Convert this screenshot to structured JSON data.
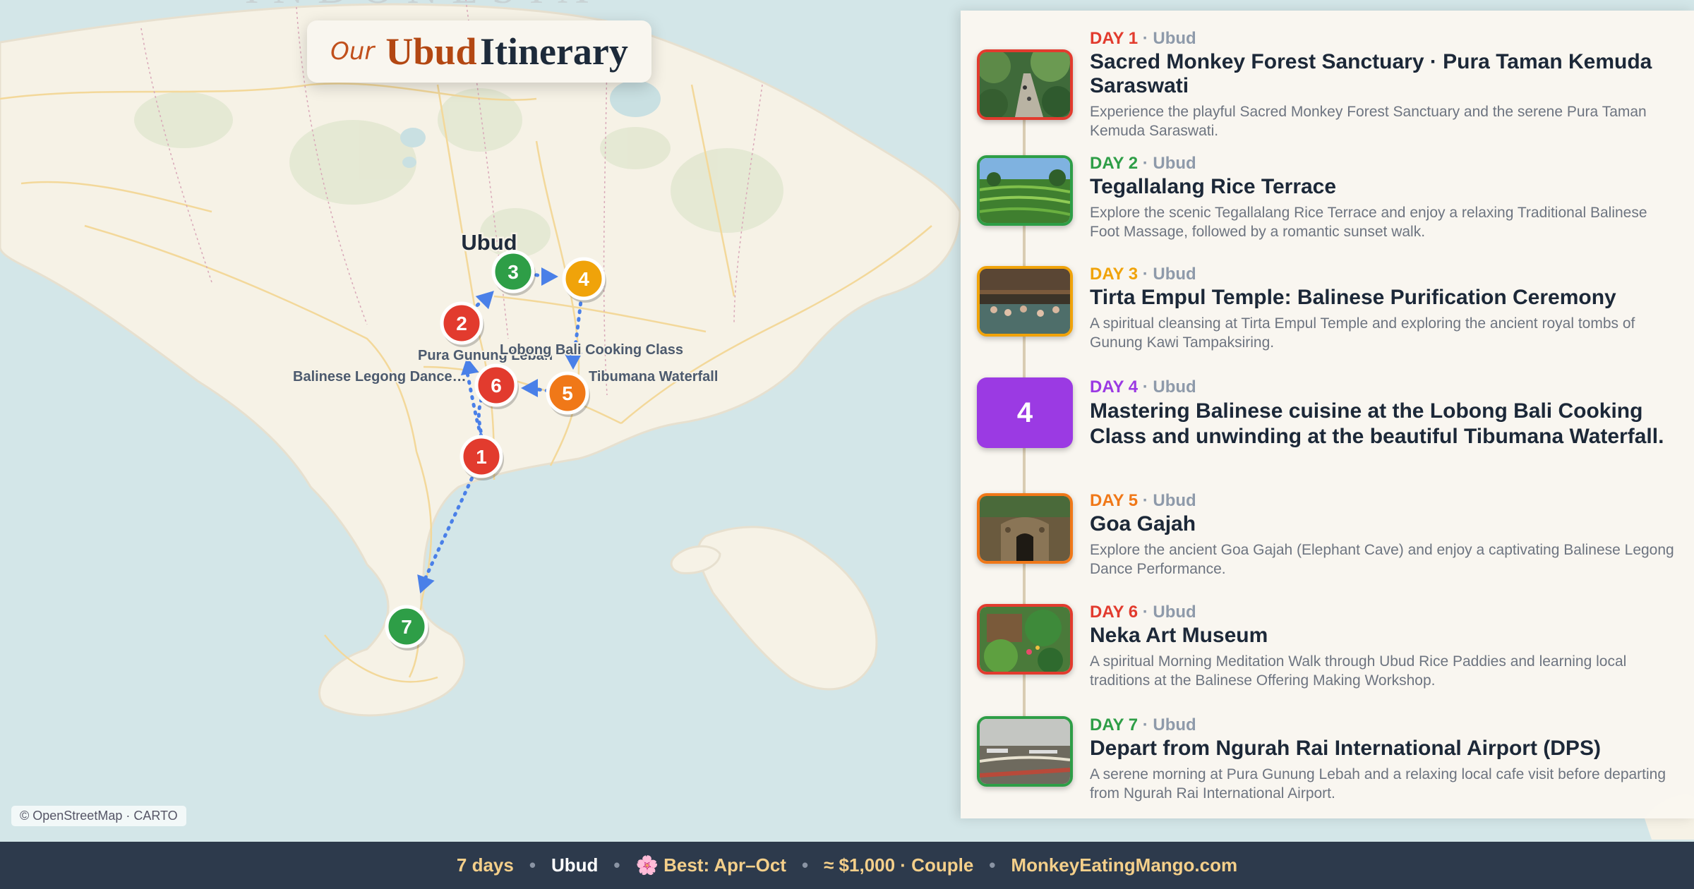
{
  "title": {
    "prefix": "Our",
    "city": "Ubud",
    "word": "Itinerary"
  },
  "map": {
    "region_label": "Ubud",
    "copyright": "© OpenStreetMap · CARTO",
    "place_labels": [
      "Pura Gunung Lebah",
      "Lobong Bali Cooking Class",
      "Balinese Legong Dance…",
      "Tibumana Waterfall"
    ],
    "markers": [
      {
        "num": "1",
        "color": "#e23b2e"
      },
      {
        "num": "2",
        "color": "#e23b2e"
      },
      {
        "num": "3",
        "color": "#2e9e47"
      },
      {
        "num": "4",
        "color": "#f0a30a"
      },
      {
        "num": "5",
        "color": "#f07818"
      },
      {
        "num": "6",
        "color": "#e23b2e"
      },
      {
        "num": "7",
        "color": "#2e9e47"
      }
    ],
    "route_color": "#4a80e8"
  },
  "days": [
    {
      "label": "DAY 1",
      "sep": "·",
      "location": "Ubud",
      "color": "#e23b2e",
      "title": "Sacred Monkey Forest Sanctuary · Pura Taman Kemuda Saraswati",
      "desc": "Experience the playful Sacred Monkey Forest Sanctuary and the serene Pura Taman Kemuda Saraswati.",
      "image": "forest-path-photo"
    },
    {
      "label": "DAY 2",
      "sep": "·",
      "location": "Ubud",
      "color": "#2e9e47",
      "title": "Tegallalang Rice Terrace",
      "desc": "Explore the scenic Tegallalang Rice Terrace and enjoy a relaxing Traditional Balinese Foot Massage, followed by a romantic sunset walk.",
      "image": "rice-terrace-photo"
    },
    {
      "label": "DAY 3",
      "sep": "·",
      "location": "Ubud",
      "color": "#f0a30a",
      "title": "Tirta Empul Temple: Balinese Purification Ceremony",
      "desc": "A spiritual cleansing at Tirta Empul Temple and exploring the ancient royal tombs of Gunung Kawi Tampaksiring.",
      "image": "temple-pool-photo"
    },
    {
      "label": "DAY 4",
      "sep": "·",
      "location": "Ubud",
      "color": "#9b3ae3",
      "title": "Mastering Balinese cuisine at the Lobong Bali Cooking Class and unwinding at the beautiful Tibumana Waterfall.",
      "desc": "",
      "number": "4"
    },
    {
      "label": "DAY 5",
      "sep": "·",
      "location": "Ubud",
      "color": "#f07818",
      "title": "Goa Gajah",
      "desc": "Explore the ancient Goa Gajah (Elephant Cave) and enjoy a captivating Balinese Legong Dance Performance.",
      "image": "cave-entrance-photo"
    },
    {
      "label": "DAY 6",
      "sep": "·",
      "location": "Ubud",
      "color": "#e23b2e",
      "title": "Neka Art Museum",
      "desc": "A spiritual Morning Meditation Walk through Ubud Rice Paddies and learning local traditions at the Balinese Offering Making Workshop.",
      "image": "garden-museum-photo"
    },
    {
      "label": "DAY 7",
      "sep": "·",
      "location": "Ubud",
      "color": "#2e9e47",
      "title": "Depart from Ngurah Rai International Airport (DPS)",
      "desc": "A serene morning at Pura Gunung Lebah and a relaxing local cafe visit before departing from Ngurah Rai International Airport.",
      "image": "airport-photo"
    }
  ],
  "footer": {
    "duration": "7 days",
    "city": "Ubud",
    "season_icon": "🌸",
    "season": "Best: Apr–Oct",
    "budget": "≈ $1,000 · Couple",
    "site": "MonkeyEatingMango.com",
    "bullet": "•"
  }
}
